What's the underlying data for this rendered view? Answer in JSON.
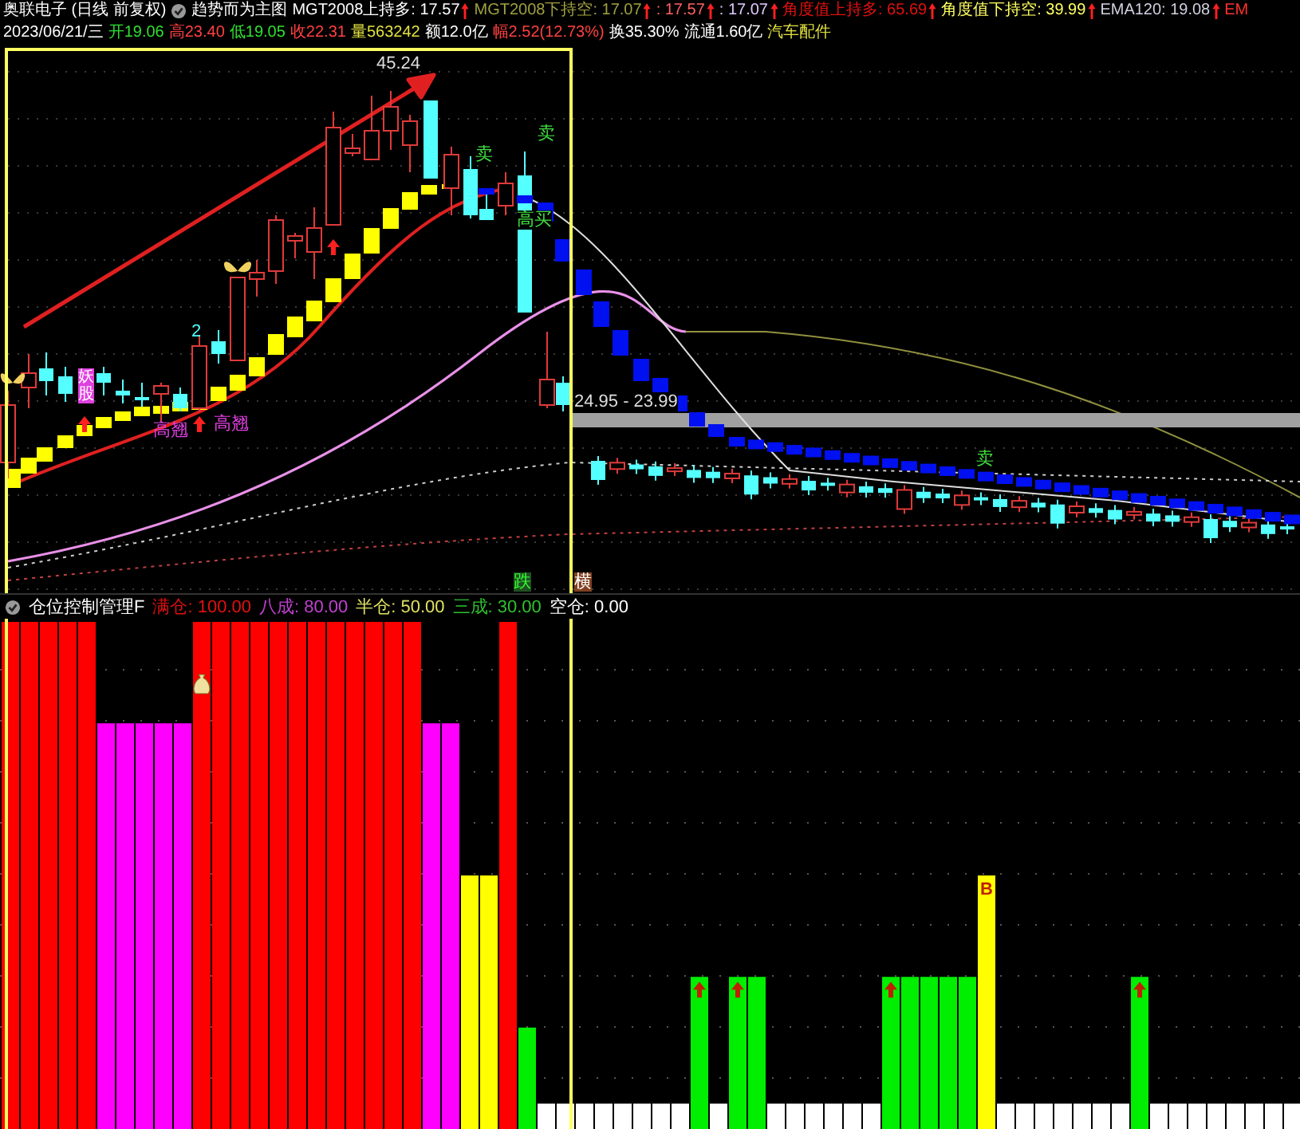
{
  "header": {
    "stock": "奥联电子 (日线 前复权)",
    "formula": "趋势而为主图",
    "indicators": [
      {
        "text": "MGT2008上持多: 17.57",
        "color": "#ffffff",
        "arrow": true
      },
      {
        "text": "MGT2008下持空: 17.07",
        "color": "#a0a040",
        "arrow": true
      },
      {
        "text": ": 17.57",
        "color": "#ff6060",
        "arrow": true
      },
      {
        "text": ": 17.07",
        "color": "#e0c8ff",
        "arrow": true
      },
      {
        "text": "角度值上持多: 65.69",
        "color": "#e01010",
        "arrow": true
      },
      {
        "text": "角度值下持空: 39.99",
        "color": "#ffff60",
        "arrow": true
      },
      {
        "text": "EMA120: 19.08",
        "color": "#d0d0e0",
        "arrow": true
      },
      {
        "text": "EM",
        "color": "#ff3030",
        "arrow": false
      }
    ],
    "quote": [
      {
        "text": "2023/06/21/三",
        "color": "#ffffff"
      },
      {
        "text": "开19.06",
        "color": "#30e030"
      },
      {
        "text": "高23.40",
        "color": "#ff4040"
      },
      {
        "text": "低19.05",
        "color": "#30e030"
      },
      {
        "text": "收22.31",
        "color": "#ff4040"
      },
      {
        "text": "量563242",
        "color": "#e0e040"
      },
      {
        "text": "额12.0亿",
        "color": "#ffffff"
      },
      {
        "text": "幅2.52(12.73%)",
        "color": "#ff4040"
      },
      {
        "text": "换35.30%",
        "color": "#ffffff"
      },
      {
        "text": "流通1.60亿",
        "color": "#ffffff"
      },
      {
        "text": "汽车配件",
        "color": "#e0e040"
      }
    ]
  },
  "chart_labels": [
    {
      "text": "45.24",
      "kind": "price"
    },
    {
      "text": "2",
      "kind": "count"
    },
    {
      "text": "妖股",
      "kind": "tag"
    },
    {
      "text": "高翘",
      "kind": "signal"
    },
    {
      "text": "高翘",
      "kind": "signal"
    },
    {
      "text": "卖",
      "kind": "sell"
    },
    {
      "text": "卖",
      "kind": "sell"
    },
    {
      "text": "高买",
      "kind": "buy"
    },
    {
      "text": "卖",
      "kind": "sell"
    },
    {
      "text": "24.95 - 23.99",
      "kind": "range"
    },
    {
      "text": "跌",
      "kind": "down"
    },
    {
      "text": "横",
      "kind": "flat"
    }
  ],
  "position_panel": {
    "title": "仓位控制管理F",
    "legend": [
      {
        "text": "满仓: 100.00",
        "color": "#e01010"
      },
      {
        "text": "八成: 80.00",
        "color": "#c040d0"
      },
      {
        "text": "半仓: 50.00",
        "color": "#e0e060"
      },
      {
        "text": "三成: 30.00",
        "color": "#30c030"
      },
      {
        "text": "空仓: 0.00",
        "color": "#ffffff"
      }
    ],
    "marker_label": "B"
  }
}
